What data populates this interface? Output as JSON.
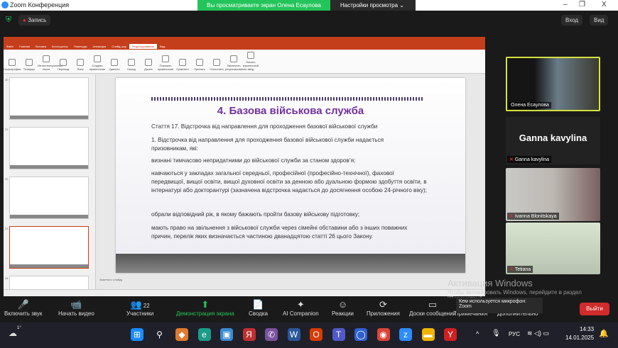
{
  "window": {
    "title": "Zoom Конференция",
    "banner": "Вы просматриваете экран Олена Есаулова",
    "view_settings": "Настройки просмотра",
    "minimize": "–",
    "restore": "❐",
    "close": "X"
  },
  "topbar": {
    "record": "Запись",
    "login": "Вход",
    "view": "Вид"
  },
  "ppt": {
    "tabs": [
      "Файл",
      "Главная",
      "Вставка",
      "Конструктор",
      "Переходы",
      "Анимация",
      "Слайд-шоу",
      "Рецензирование",
      "Вид"
    ],
    "active_tab": "Рецензирование",
    "ribbon": [
      "Орфография",
      "Тезаурус",
      "Интеллектуальный поиск",
      "Перевод",
      "Язык",
      "Создать примечание",
      "Удалить",
      "Назад",
      "Далее",
      "Показать примечания",
      "Сравнить",
      "Принять",
      "Отклонить",
      "Закончить рецензирование",
      "Начать рукописный ввод"
    ],
    "thumb_numbers": [
      "20",
      "21",
      "22",
      "23",
      "24"
    ],
    "notes": "Заметки к слайду"
  },
  "slide": {
    "title": "4. Базова військова служба",
    "paragraphs": [
      "Стаття 17. Відстрочка від направлення для проходження базової військової служби",
      "1. Відстрочка від направлення для проходження базової військової служби надається призовникам, які:",
      "визнані тимчасово непридатними до військової служби за станом здоров’я;",
      "навчаються у закладах загальної середньої, професійної (професійно-технічної), фахової передвищої, вищої освіти, вищої духовної освіти за денною або дуальною формою здобуття освіти, в інтернатурі або докторантурі (зазначена відстрочка надається до досягнення особою 24-річного віку);",
      "обрали відповідний рік, в якому бажають пройти базову військову підготовку;",
      "мають право на звільнення з військової служби через сімейні обставини або з інших поважних причин, перелік яких визначається частиною дванадцятою статті 26 цього Закону."
    ]
  },
  "participants_panel": [
    {
      "name": "Олена Есаулова",
      "active_speaker": true
    },
    {
      "name": "Ganna kavylina",
      "big_name": "Ganna kavylina",
      "muted": true
    },
    {
      "name": "Ivanna Blonitskaya",
      "muted": true
    },
    {
      "name": "Tetiana",
      "muted": true
    }
  ],
  "windows_activation": {
    "title": "Активация Windows",
    "text": "Чтобы активировать Windows, перейдите в раздел \"Параметры\"."
  },
  "tooltip": "Кем используется микрофон: Zoom",
  "toolbar": {
    "items": [
      "Включить звук",
      "Начать видео",
      "Участники",
      "Демонстрация экрана",
      "Сводка",
      "AI Companion",
      "Реакции",
      "Приложения",
      "Доски сообщений",
      "Примечания",
      "Дополнительно"
    ],
    "participants_count": "22",
    "leave": "Выйти"
  },
  "taskbar": {
    "weather": "1°",
    "lang": "РУС",
    "time": "14:33",
    "date": "14.01.2025"
  },
  "colors": {
    "ppt_accent": "#c43e1c",
    "banner": "#23c45a",
    "leave": "#d12b2b",
    "slide_title": "#7030a0"
  }
}
